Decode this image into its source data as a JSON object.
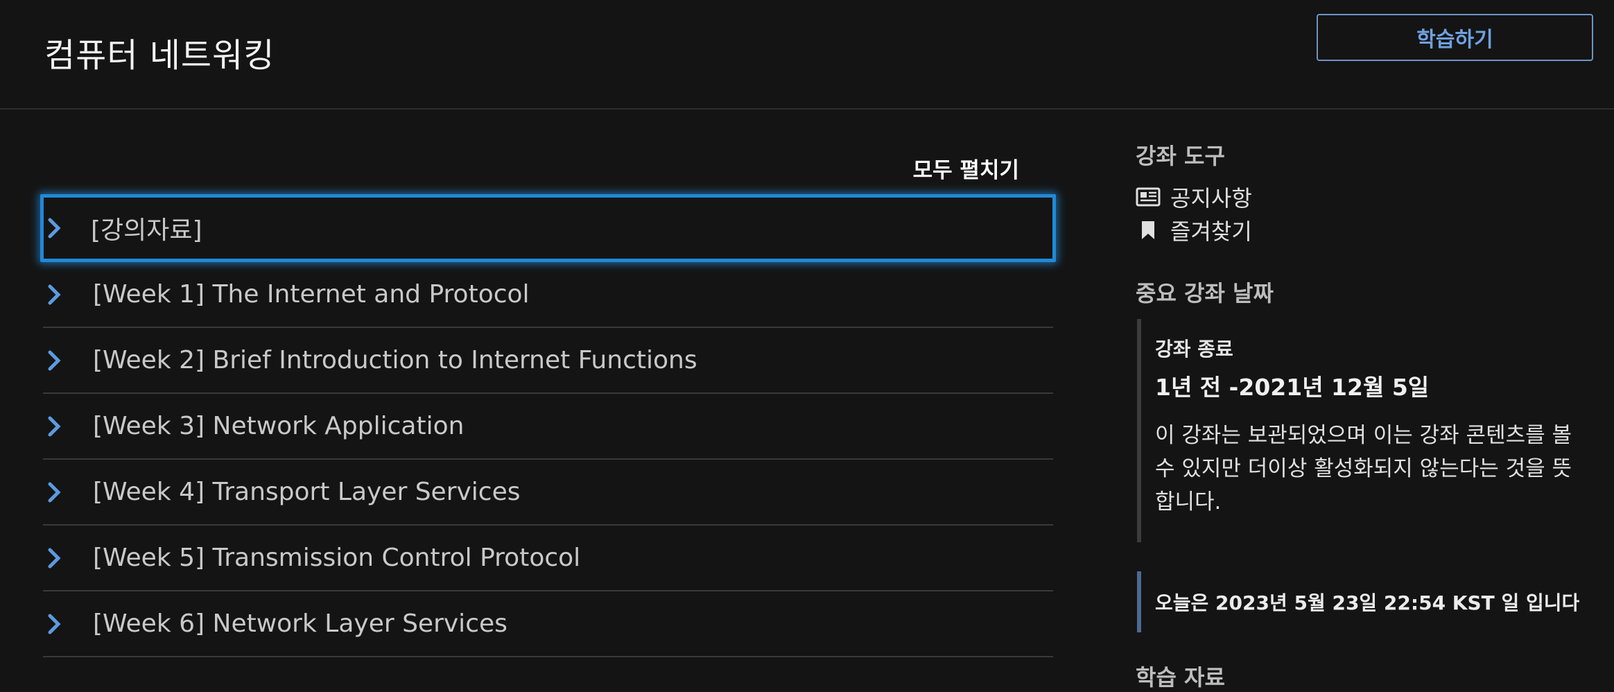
{
  "header": {
    "course_title": "컴퓨터 네트워킹",
    "resume_label": "학습하기"
  },
  "outline": {
    "expand_all_label": "모두 펼치기",
    "sections": [
      {
        "label": "[강의자료]"
      },
      {
        "label": "[Week 1] The Internet and Protocol"
      },
      {
        "label": "[Week 2] Brief Introduction to Internet Functions"
      },
      {
        "label": "[Week 3] Network Application"
      },
      {
        "label": "[Week 4] Transport Layer Services"
      },
      {
        "label": "[Week 5] Transmission Control Protocol"
      },
      {
        "label": "[Week 6] Network Layer Services"
      }
    ]
  },
  "sidebar": {
    "tools_heading": "강좌 도구",
    "tools": [
      {
        "label": "공지사항",
        "icon": "newspaper-icon"
      },
      {
        "label": "즐겨찾기",
        "icon": "bookmark-icon"
      }
    ],
    "dates_heading": "중요 강좌 날짜",
    "course_end_title": "강좌 종료",
    "course_end_value": "1년 전 -2021년 12월 5일",
    "course_end_desc": "이 강좌는 보관되었으며 이는 강좌 콘텐츠를 볼 수 있지만 더이상 활성화되지 않는다는 것을 뜻합니다.",
    "today_text": "오늘은 2023년 5월 23일 22:54 KST 일 입니다",
    "materials_heading": "학습 자료"
  },
  "colors": {
    "background": "#141414",
    "accent": "#6fa1e0",
    "focus_ring": "#1f8ad8"
  }
}
